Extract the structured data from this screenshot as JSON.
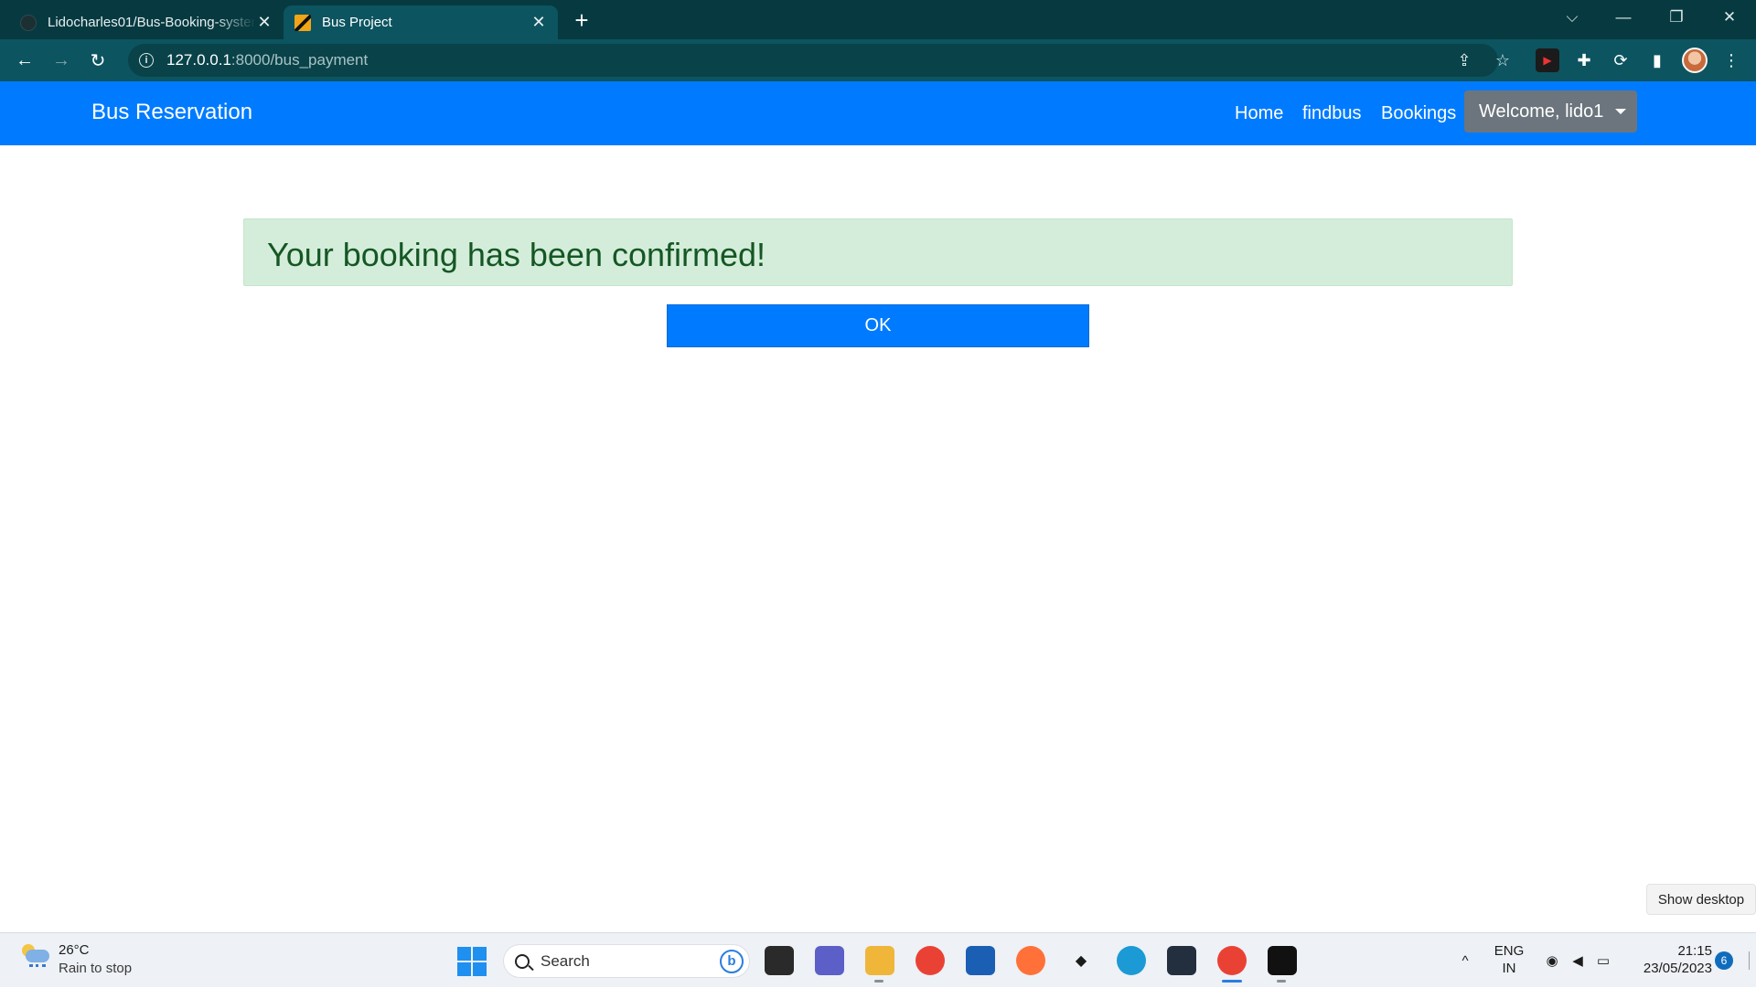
{
  "browser": {
    "tabs": [
      {
        "title": "Lidocharles01/Bus-Booking-system",
        "close": "✕"
      },
      {
        "title": "Bus Project",
        "close": "✕"
      }
    ],
    "new_tab": "+",
    "window_controls": {
      "dropdown": "⌵",
      "minimize": "—",
      "restore": "❐",
      "close": "✕"
    },
    "nav": {
      "back": "←",
      "forward": "→",
      "reload": "↻"
    },
    "address": {
      "host": "127.0.0.1",
      "rest": ":8000/bus_payment"
    },
    "omnibox_icons": {
      "share": "⇪",
      "bookmark": "☆"
    },
    "extensions": {
      "terminal": "▶",
      "puzzle": "✚",
      "sync": "⟳",
      "sidepanel": "▮",
      "menu": "⋮"
    }
  },
  "site": {
    "brand": "Bus Reservation",
    "nav": [
      {
        "label": "Home"
      },
      {
        "label": "findbus"
      },
      {
        "label": "Bookings"
      }
    ],
    "user_menu": "Welcome, lido1"
  },
  "main": {
    "alert_message": "Your booking has been confirmed!",
    "ok_button": "OK"
  },
  "desktop": {
    "show_desktop": "Show desktop"
  },
  "taskbar": {
    "weather": {
      "temp": "26°C",
      "desc": "Rain to stop"
    },
    "search_placeholder": "Search",
    "bing": "b",
    "apps": [
      {
        "name": "task-view",
        "color": "#2a2a2a"
      },
      {
        "name": "meet",
        "color": "#5b5fc7"
      },
      {
        "name": "file-explorer",
        "color": "#f0b63a"
      },
      {
        "name": "chrome",
        "color": "#e94235"
      },
      {
        "name": "store",
        "color": "#1a5fb4"
      },
      {
        "name": "firefox",
        "color": "#ff7139"
      },
      {
        "name": "dropbox",
        "color": "#1b1b1b"
      },
      {
        "name": "edge",
        "color": "#1c9ad6"
      },
      {
        "name": "amazon",
        "color": "#232f3e"
      },
      {
        "name": "chrome-profile",
        "color": "#e94235"
      },
      {
        "name": "pycharm",
        "color": "#111111"
      }
    ],
    "tray": {
      "chevron": "^",
      "wifi": "◉",
      "volume": "◀",
      "battery": "▭"
    },
    "language": {
      "line1": "ENG",
      "line2": "IN"
    },
    "clock": {
      "time": "21:15",
      "date": "23/05/2023"
    },
    "notifications": "6"
  }
}
